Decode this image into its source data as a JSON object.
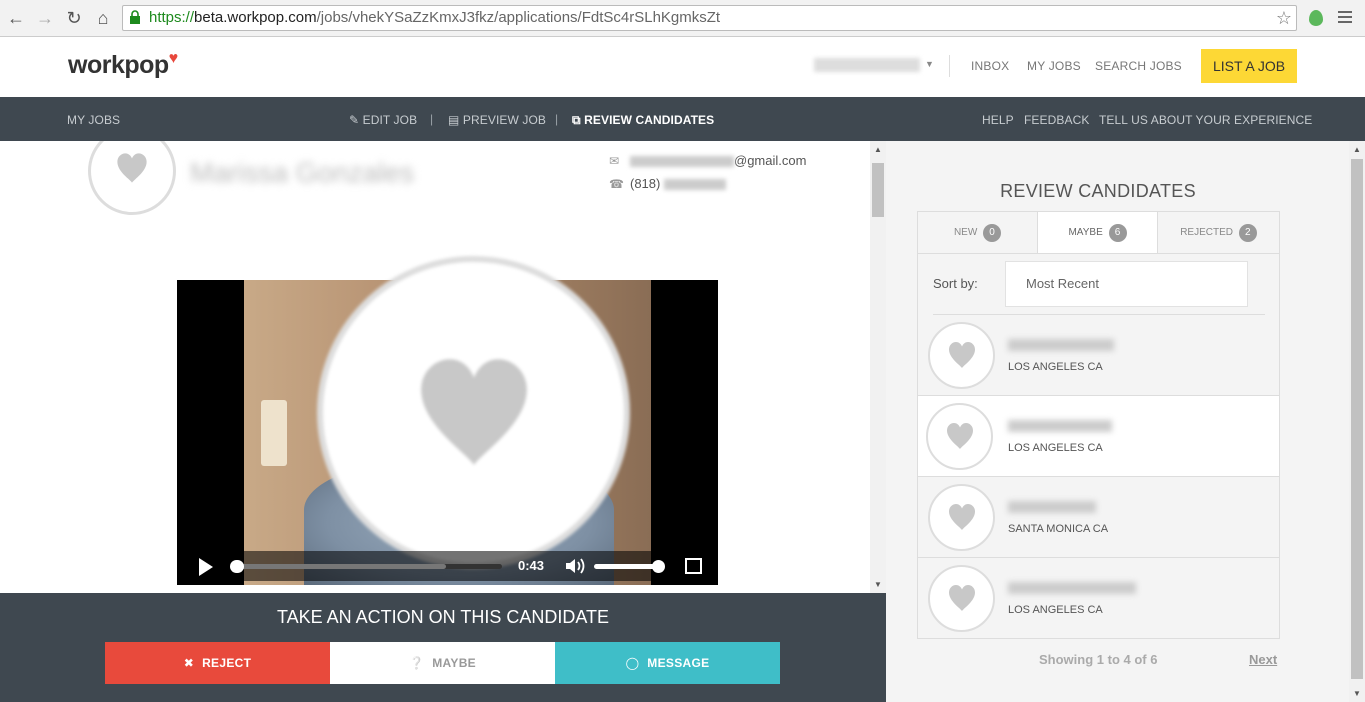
{
  "browser": {
    "url_scheme": "https://",
    "url_host": "beta.workpop.com",
    "url_path": "/jobs/vhekYSaZzKmxJ3fkz/applications/FdtSc4rSLhKgmksZt"
  },
  "header": {
    "logo": "workpop",
    "logo_mark": "♥",
    "links": {
      "inbox": "INBOX",
      "my_jobs": "MY JOBS",
      "search_jobs": "SEARCH JOBS"
    },
    "list_job": "LIST A JOB"
  },
  "subnav": {
    "my_jobs": "MY JOBS",
    "edit_job": "EDIT JOB",
    "preview_job": "PREVIEW JOB",
    "review_candidates": "REVIEW CANDIDATES",
    "separator": "|",
    "help": "HELP",
    "feedback": "FEEDBACK",
    "tell_us": "TELL US ABOUT YOUR EXPERIENCE"
  },
  "candidate": {
    "name": "Marissa Gonzales",
    "email_suffix": "@gmail.com",
    "phone_prefix": "(818)"
  },
  "video": {
    "time": "0:43",
    "progress": 0.0,
    "buffered": 0.79,
    "volume": 1.0
  },
  "actions": {
    "title": "TAKE AN ACTION ON THIS CANDIDATE",
    "reject": "REJECT",
    "maybe": "MAYBE",
    "message": "MESSAGE"
  },
  "review": {
    "title": "REVIEW CANDIDATES",
    "tabs": [
      {
        "label": "NEW",
        "count": "0"
      },
      {
        "label": "MAYBE",
        "count": "6"
      },
      {
        "label": "REJECTED",
        "count": "2"
      }
    ],
    "sort_label": "Sort by:",
    "sort_value": "Most Recent",
    "candidates": [
      {
        "location": "LOS ANGELES CA"
      },
      {
        "location": "LOS ANGELES CA"
      },
      {
        "location": "SANTA MONICA CA"
      },
      {
        "location": "LOS ANGELES CA"
      }
    ],
    "pager_text": "Showing 1 to 4 of 6",
    "pager_next": "Next"
  },
  "colors": {
    "brand_heart": "#e8483c",
    "list_job_bg": "#fdd835",
    "nav_bg": "#3f4850",
    "reject": "#e84a3c",
    "message": "#3fbec8"
  }
}
